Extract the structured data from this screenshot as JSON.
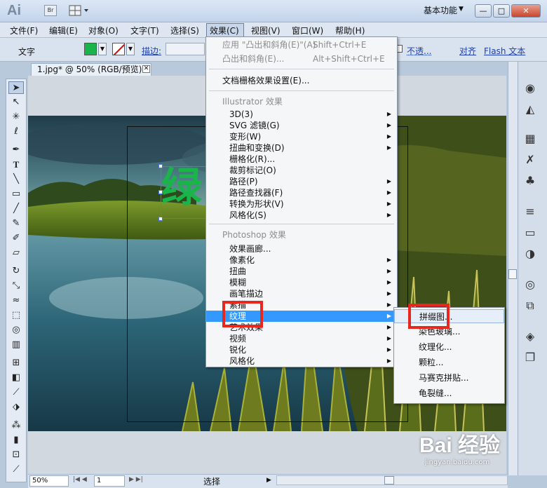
{
  "app": {
    "logo": "Ai",
    "bridge_label": "Br",
    "workspace": "基本功能",
    "window_buttons": {
      "minimize": "—",
      "maximize": "□",
      "close": "✕"
    }
  },
  "menubar": {
    "items": [
      "文件(F)",
      "编辑(E)",
      "对象(O)",
      "文字(T)",
      "选择(S)",
      "效果(C)",
      "视图(V)",
      "窗口(W)",
      "帮助(H)"
    ],
    "active": "效果(C)"
  },
  "controlbar": {
    "tool_label": "文字",
    "stroke_label": "描边:",
    "opacity_label": "不透...",
    "align_label": "对齐",
    "flash_label": "Flash 文本",
    "fill_color": "#19b54a"
  },
  "document": {
    "tab_title": "1.jpg* @ 50% (RGB/预览)",
    "selected_text": "绿",
    "text_color": "#19b54a"
  },
  "status": {
    "zoom": "50%",
    "page": "1",
    "tool": "选择"
  },
  "effect_menu": {
    "apply_last": {
      "label": "应用 \"凸出和斜角(E)\"(A)",
      "shortcut": "Shift+Ctrl+E"
    },
    "last_effect": {
      "label": "凸出和斜角(E)...",
      "shortcut": "Alt+Shift+Ctrl+E"
    },
    "raster_settings": "文档栅格效果设置(E)...",
    "illustrator_header": "Illustrator 效果",
    "illustrator_items": [
      {
        "label": "3D(3)",
        "sub": true
      },
      {
        "label": "SVG 滤镜(G)",
        "sub": true
      },
      {
        "label": "变形(W)",
        "sub": true
      },
      {
        "label": "扭曲和变换(D)",
        "sub": true
      },
      {
        "label": "栅格化(R)...",
        "sub": false
      },
      {
        "label": "裁剪标记(O)",
        "sub": false
      },
      {
        "label": "路径(P)",
        "sub": true
      },
      {
        "label": "路径查找器(F)",
        "sub": true
      },
      {
        "label": "转换为形状(V)",
        "sub": true
      },
      {
        "label": "风格化(S)",
        "sub": true
      }
    ],
    "photoshop_header": "Photoshop 效果",
    "photoshop_items": [
      {
        "label": "效果画廊...",
        "sub": false
      },
      {
        "label": "像素化",
        "sub": true
      },
      {
        "label": "扭曲",
        "sub": true
      },
      {
        "label": "模糊",
        "sub": true
      },
      {
        "label": "画笔描边",
        "sub": true
      },
      {
        "label": "素描",
        "sub": true
      },
      {
        "label": "纹理",
        "sub": true,
        "highlighted": true
      },
      {
        "label": "艺术效果",
        "sub": true
      },
      {
        "label": "视频",
        "sub": true
      },
      {
        "label": "锐化",
        "sub": true
      },
      {
        "label": "风格化",
        "sub": true
      }
    ]
  },
  "texture_submenu": {
    "items": [
      {
        "label": "拼缀图...",
        "highlighted": true
      },
      {
        "label": "染色玻璃..."
      },
      {
        "label": "纹理化..."
      },
      {
        "label": "颗粒..."
      },
      {
        "label": "马赛克拼贴..."
      },
      {
        "label": "龟裂缝..."
      }
    ]
  },
  "watermark": {
    "logo": "Bai 经验",
    "url": "jingyan.baidu.com"
  },
  "icons": [
    "selection-icon",
    "direct-selection-icon",
    "magic-wand-icon",
    "lasso-icon",
    "pen-icon",
    "type-icon",
    "line-icon",
    "rectangle-icon",
    "paintbrush-icon",
    "pencil-icon",
    "eraser-icon",
    "rotate-icon",
    "scale-icon",
    "warp-icon",
    "free-transform-icon",
    "symbol-sprayer-icon",
    "graph-icon",
    "mesh-icon",
    "gradient-icon",
    "eyedropper-icon",
    "blend-icon",
    "live-paint-icon",
    "artboard-icon",
    "slice-icon",
    "hand-icon",
    "zoom-icon"
  ]
}
